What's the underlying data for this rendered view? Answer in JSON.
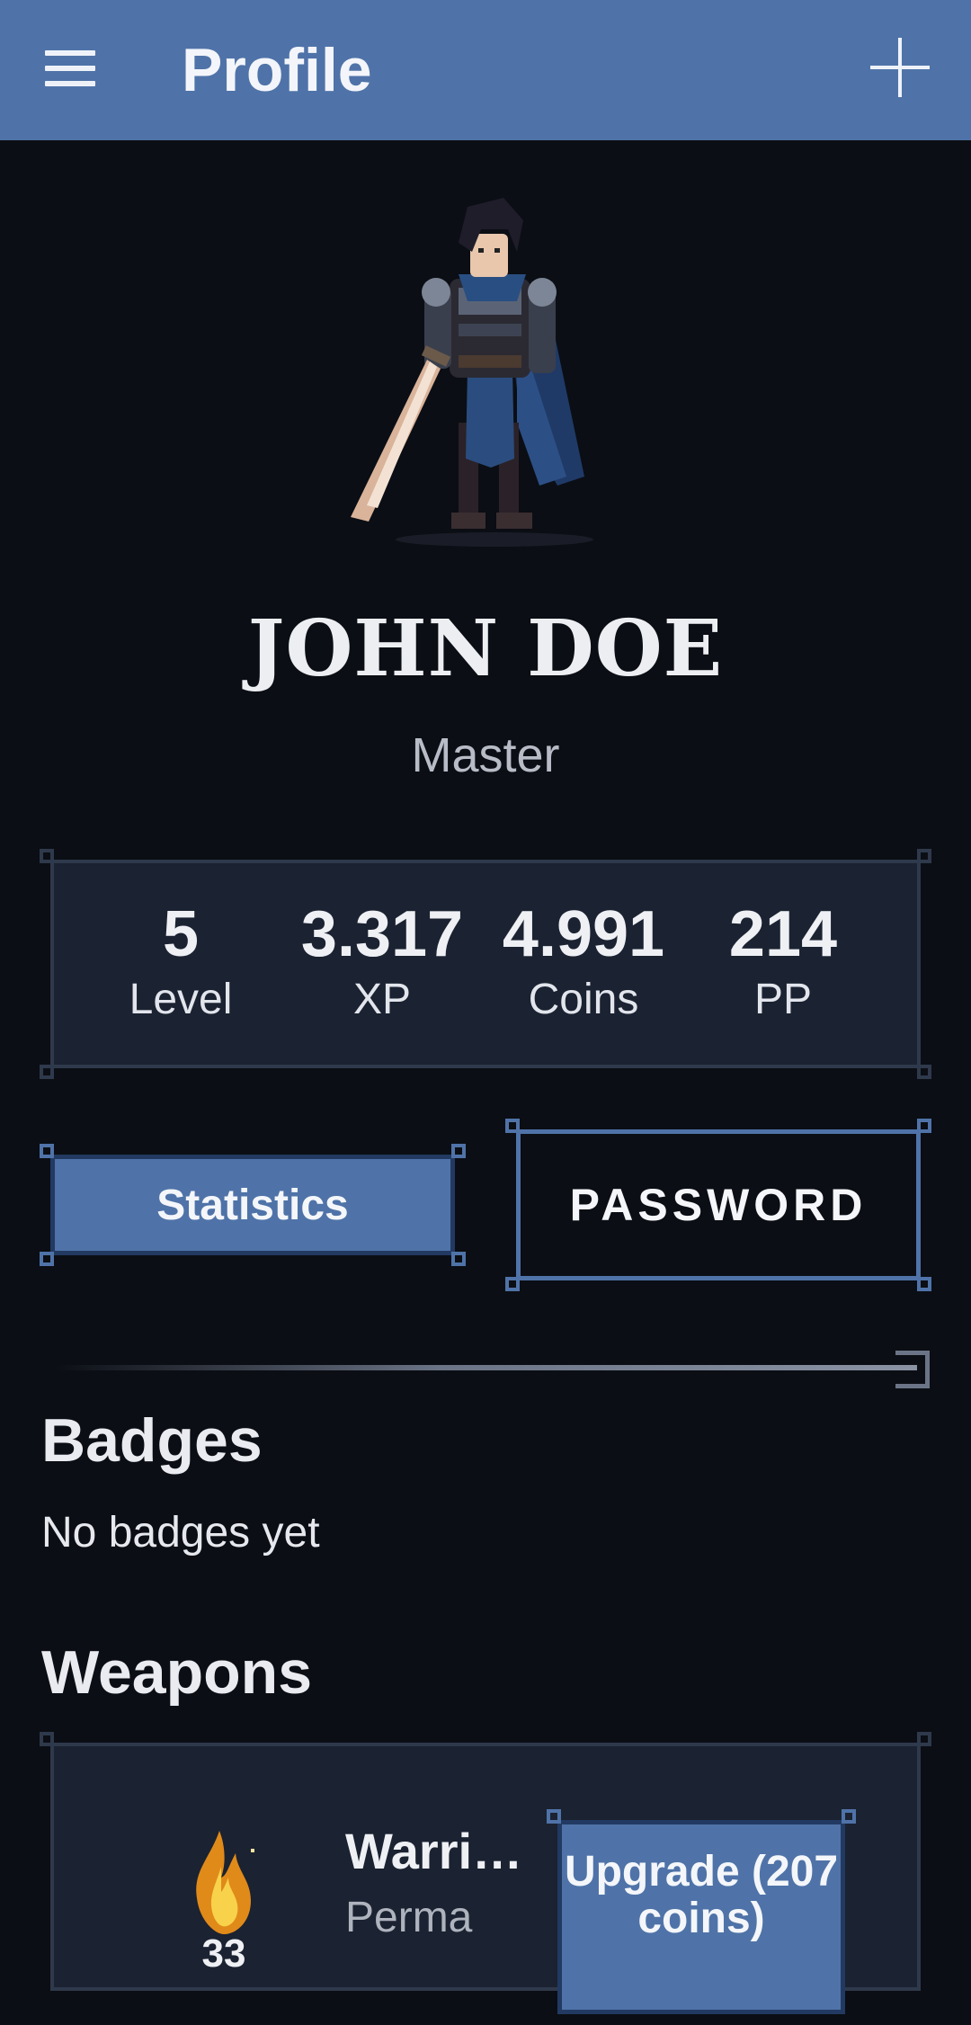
{
  "appbar": {
    "title": "Profile",
    "menu_icon": "hamburger-menu-icon",
    "add_icon": "plus-icon"
  },
  "profile": {
    "name": "JOHN DOE",
    "rank": "Master"
  },
  "stats": [
    {
      "value": "5",
      "label": "Level"
    },
    {
      "value": "3.317",
      "label": "XP"
    },
    {
      "value": "4.991",
      "label": "Coins"
    },
    {
      "value": "214",
      "label": "PP"
    }
  ],
  "buttons": {
    "statistics": "Statistics",
    "password": "PASSWORD"
  },
  "badges": {
    "heading": "Badges",
    "empty_text": "No badges yet"
  },
  "weapons": {
    "heading": "Weapons",
    "items": [
      {
        "level": "33",
        "name": "Warri…",
        "subtitle": "Perma",
        "upgrade_label": "Upgrade (207 coins)"
      }
    ]
  },
  "colors": {
    "appbar": "#4f73a8",
    "background": "#0b0e14",
    "panel": "#1b2231",
    "accent": "#4f73a8"
  }
}
